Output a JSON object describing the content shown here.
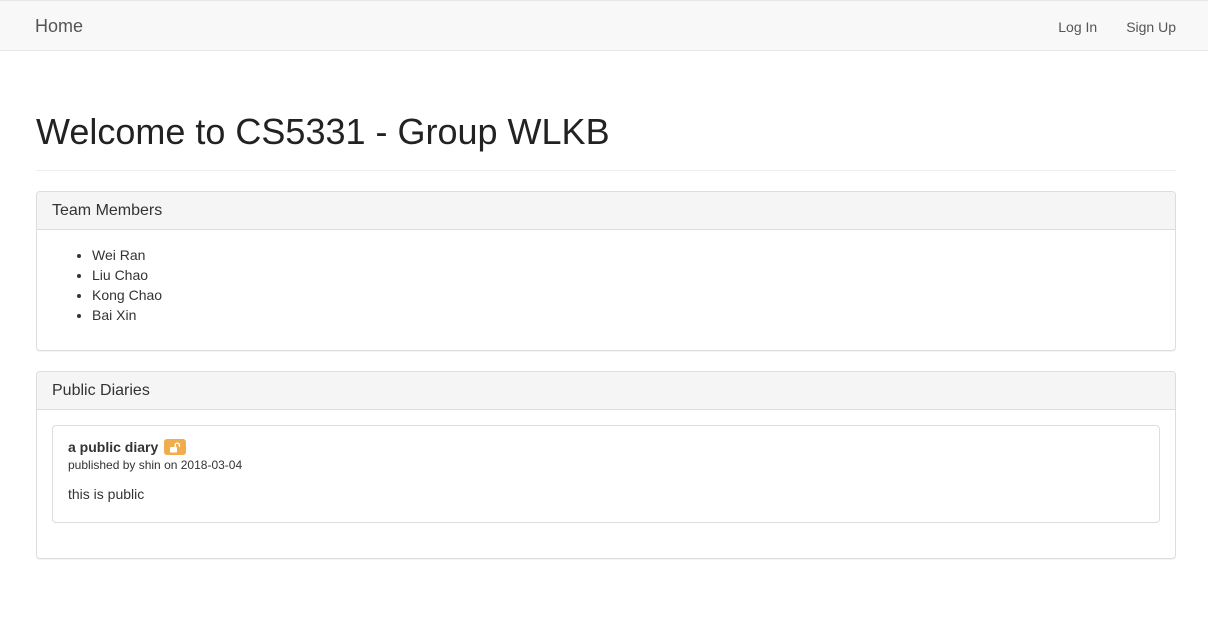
{
  "nav": {
    "brand": "Home",
    "links": [
      "Log In",
      "Sign Up"
    ]
  },
  "page": {
    "title": "Welcome to CS5331 - Group WLKB"
  },
  "team_panel": {
    "title": "Team Members",
    "members": [
      "Wei Ran",
      "Liu Chao",
      "Kong Chao",
      "Bai Xin"
    ]
  },
  "diaries_panel": {
    "title": "Public Diaries",
    "diaries": [
      {
        "title": "a public diary",
        "icon": "unlock-icon",
        "badge_color": "#f0ad4e",
        "meta": "published by shin on 2018-03-04",
        "body": "this is public"
      }
    ]
  }
}
